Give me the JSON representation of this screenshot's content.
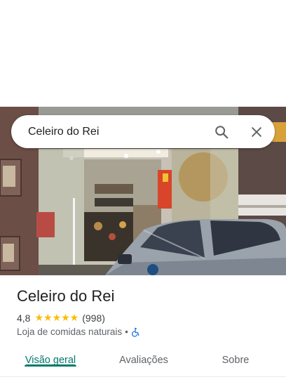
{
  "search": {
    "query": "Celeiro do Rei"
  },
  "place": {
    "name": "Celeiro do Rei",
    "rating": "4,8",
    "stars": "★★★★★",
    "review_count": "(998)",
    "category": "Loja de comidas naturais",
    "separator": "•"
  },
  "tabs": [
    {
      "label": "Visão geral",
      "active": true
    },
    {
      "label": "Avaliações",
      "active": false
    },
    {
      "label": "Sobre",
      "active": false
    }
  ],
  "colors": {
    "accent": "#00796b",
    "star": "#fbbc04",
    "accessibility": "#1a73e8"
  },
  "icons": {
    "search": "search-icon",
    "close": "close-icon",
    "accessibility": "wheelchair-icon"
  }
}
